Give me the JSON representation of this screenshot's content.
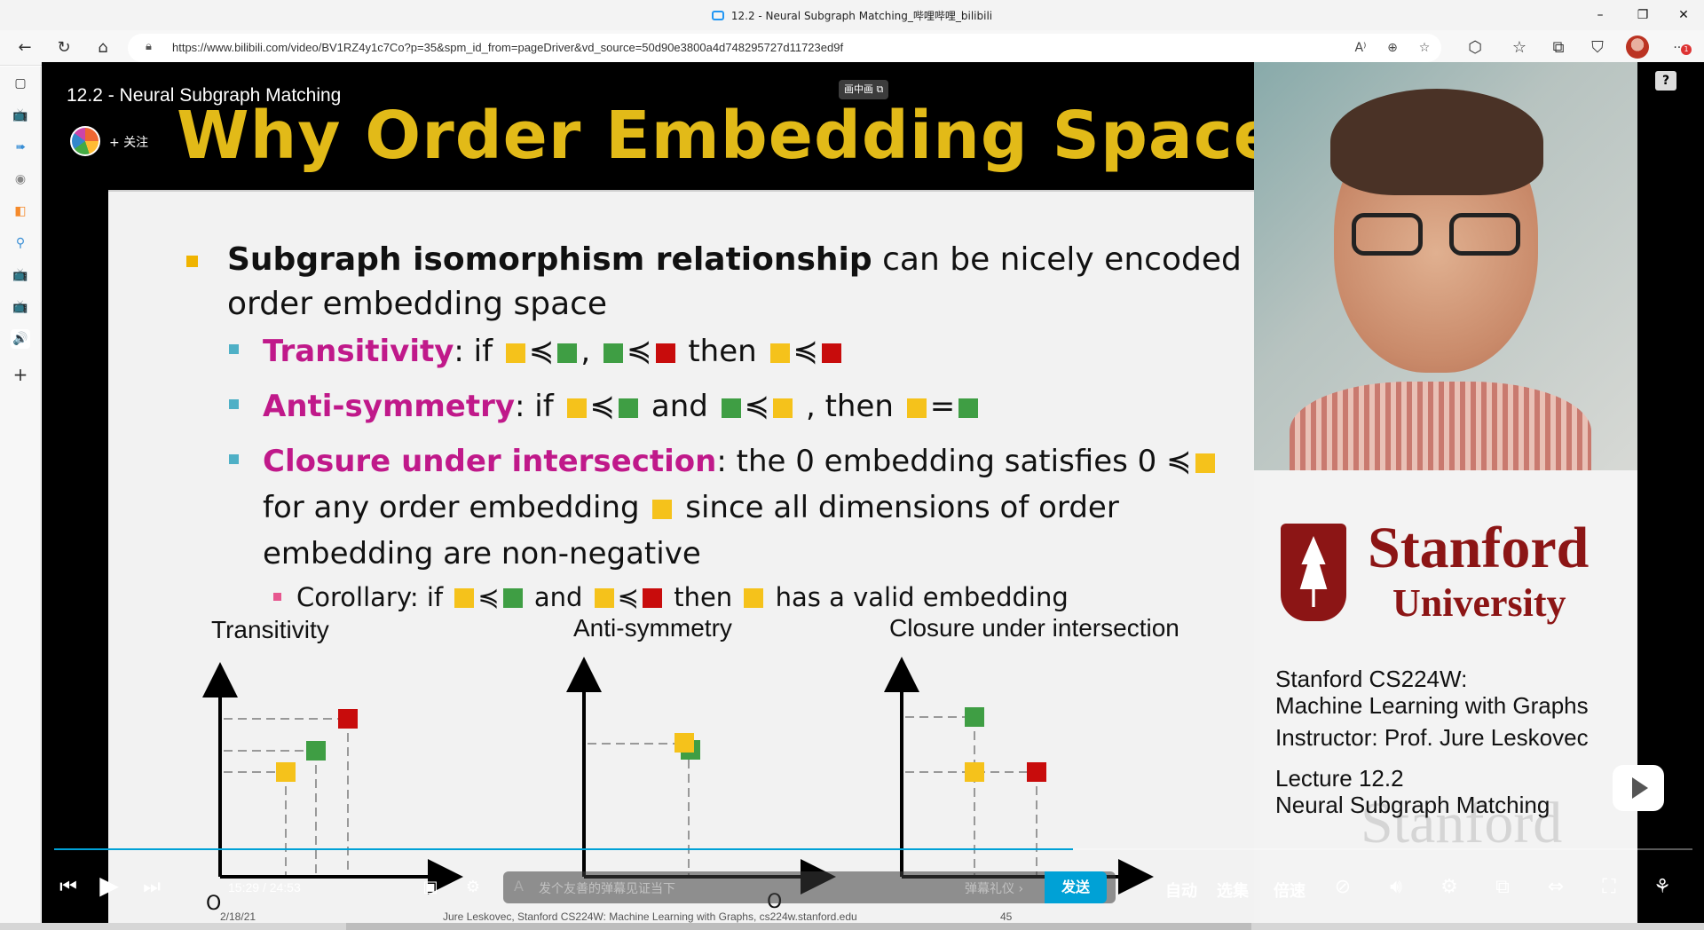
{
  "window": {
    "title": "12.2 - Neural Subgraph Matching_哔哩哔哩_bilibili",
    "minimize": "–",
    "restore": "❐",
    "close": "✕"
  },
  "address_bar": {
    "url": "https://www.bilibili.com/video/BV1RZ4y1c7Co?p=35&spm_id_from=pageDriver&vd_source=50d90e3800a4d748295727d11723ed9f",
    "read_aloud": "A⁾",
    "zoom": "⊕",
    "favorite": "☆",
    "extensions": "⬡",
    "favorites_bar": "☆",
    "collections": "⧉",
    "shield": "⛉",
    "menu": "···",
    "badge": "1"
  },
  "sidebar": {
    "items": [
      "▢",
      "📺",
      "➠",
      "◉",
      "◧",
      "⚲",
      "📺",
      "📺",
      "🔊",
      "+"
    ]
  },
  "player": {
    "video_title": "12.2 - Neural Subgraph Matching",
    "follow_label": "+ 关注",
    "pip_label": "画中画",
    "help": "?",
    "current_time": "15:29",
    "separator": "/",
    "total_time": "24:53",
    "progress_fraction": 0.622,
    "danmaku_placeholder": "发个友善的弹幕见证当下",
    "danmaku_etiquette": "弹幕礼仪 ›",
    "send_label": "发送",
    "auto_label": "自动",
    "episodes_label": "选集",
    "speed_label": "倍速",
    "accent_color": "#00a1d6"
  },
  "slide": {
    "title": "Why Order Embedding Space?",
    "bullet1_bold": "Subgraph isomorphism relationship",
    "bullet1_rest": " can be nicely encoded in",
    "bullet1_line2": "order embedding space",
    "transitivity_term": "Transitivity",
    "transitivity_if": ": if ",
    "transitivity_rel1": "≼",
    "transitivity_comma": ",",
    "transitivity_rel2": "≼",
    "transitivity_then": " then ",
    "transitivity_rel3": "≼",
    "antisym_term": "Anti-symmetry",
    "antisym_if": ": if ",
    "antisym_rel1": "≼",
    "antisym_and": " and ",
    "antisym_rel2": "≼",
    "antisym_then": " , then ",
    "antisym_eq": "=",
    "closure_term": "Closure under intersection",
    "closure_rest": ": the 0 embedding satisfies 0 ≼",
    "closure_line2a": "for any order embedding ",
    "closure_line2b": " since all dimensions of order",
    "closure_line3": "embedding are non-negative",
    "corollary_a": "Corollary: if ",
    "corollary_rel1": "≼",
    "corollary_and": " and ",
    "corollary_rel2": "≼",
    "corollary_then": " then ",
    "corollary_end": " has a valid embedding",
    "chart1_label": "Transitivity",
    "chart2_label": "Anti-symmetry",
    "chart3_label": "Closure under intersection",
    "origin_label": "O",
    "footer_date": "2/18/21",
    "footer_credit": "Jure Leskovec, Stanford CS224W: Machine Learning with Graphs, cs224w.stanford.edu",
    "footer_page": "45",
    "colors": {
      "title": "#e2ba18",
      "term": "#c0198a",
      "yellow": "#f5c21b",
      "green": "#3f9e44",
      "red": "#c80c0c",
      "bullet_l1": "#f0b400",
      "bullet_l2": "#4fb0c6",
      "bullet_l3": "#e7578f"
    }
  },
  "side_panel": {
    "university_name": "Stanford",
    "university_word": "University",
    "course_line1": "Stanford CS224W:",
    "course_line2": "Machine Learning with Graphs",
    "instructor": "Instructor: Prof. Jure Leskovec",
    "lecture_line1": "Lecture 12.2",
    "lecture_line2": "Neural Subgraph Matching",
    "watermark": "Stanford",
    "brand_color": "#8c1515"
  }
}
